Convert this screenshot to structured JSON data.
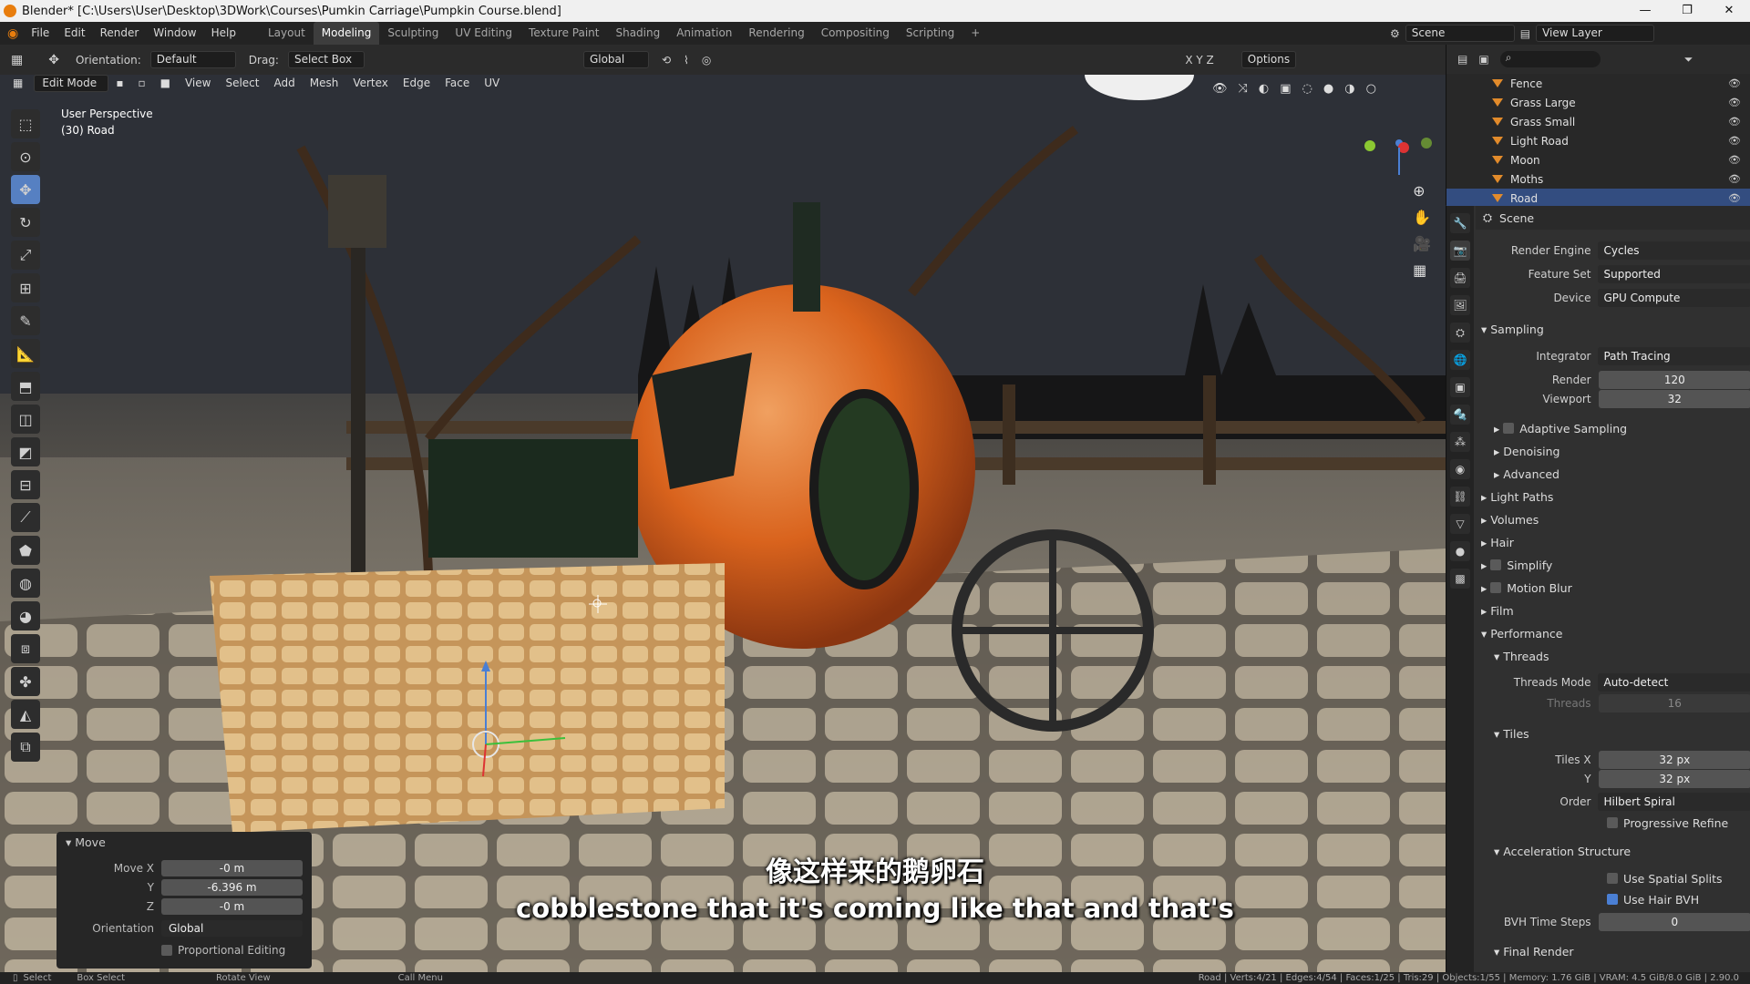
{
  "window": {
    "title": "Blender* [C:\\Users\\User\\Desktop\\3DWork\\Courses\\Pumkin Carriage\\Pumpkin Course.blend]"
  },
  "menu": [
    "File",
    "Edit",
    "Render",
    "Window",
    "Help"
  ],
  "workspaces": [
    "Layout",
    "Modeling",
    "Sculpting",
    "UV Editing",
    "Texture Paint",
    "Shading",
    "Animation",
    "Rendering",
    "Compositing",
    "Scripting"
  ],
  "active_workspace": "Modeling",
  "scene_field": "Scene",
  "view_layer_field": "View Layer",
  "header": {
    "orientation_label": "Orientation:",
    "orientation_value": "Default",
    "drag_label": "Drag:",
    "drag_value": "Select Box",
    "transform_space": "Global",
    "options": "Options"
  },
  "edit_header": {
    "mode": "Edit Mode",
    "items": [
      "View",
      "Select",
      "Add",
      "Mesh",
      "Vertex",
      "Edge",
      "Face",
      "UV"
    ]
  },
  "viewport": {
    "perspective": "User Perspective",
    "object": "(30) Road"
  },
  "outliner": [
    {
      "name": "Fence",
      "selected": false
    },
    {
      "name": "Grass Large",
      "selected": false
    },
    {
      "name": "Grass Small",
      "selected": false
    },
    {
      "name": "Light Road",
      "selected": false
    },
    {
      "name": "Moon",
      "selected": false
    },
    {
      "name": "Moths",
      "selected": false
    },
    {
      "name": "Road",
      "selected": true
    }
  ],
  "props": {
    "scene_title": "Scene",
    "render_engine": {
      "label": "Render Engine",
      "value": "Cycles"
    },
    "feature_set": {
      "label": "Feature Set",
      "value": "Supported"
    },
    "device": {
      "label": "Device",
      "value": "GPU Compute"
    },
    "sampling": "Sampling",
    "integrator": {
      "label": "Integrator",
      "value": "Path Tracing"
    },
    "render": {
      "label": "Render",
      "value": "120"
    },
    "viewport": {
      "label": "Viewport",
      "value": "32"
    },
    "adaptive": "Adaptive Sampling",
    "denoising": "Denoising",
    "advanced": "Advanced",
    "light_paths": "Light Paths",
    "volumes": "Volumes",
    "hair": "Hair",
    "simplify": "Simplify",
    "motion_blur": "Motion Blur",
    "film": "Film",
    "performance": "Performance",
    "threads": "Threads",
    "threads_mode": {
      "label": "Threads Mode",
      "value": "Auto-detect"
    },
    "threads_count": {
      "label": "Threads",
      "value": "16"
    },
    "tiles": "Tiles",
    "tiles_x": {
      "label": "Tiles X",
      "value": "32 px"
    },
    "tiles_y": {
      "label": "Y",
      "value": "32 px"
    },
    "order": {
      "label": "Order",
      "value": "Hilbert Spiral"
    },
    "progressive": "Progressive Refine",
    "accel": "Acceleration Structure",
    "spatial": "Use Spatial Splits",
    "hair_bvh": "Use Hair BVH",
    "bvh_steps": {
      "label": "BVH Time Steps",
      "value": "0"
    },
    "final_render": "Final Render"
  },
  "move_panel": {
    "title": "Move",
    "move_x": {
      "label": "Move X",
      "value": "-0 m"
    },
    "y": {
      "label": "Y",
      "value": "-6.396 m"
    },
    "z": {
      "label": "Z",
      "value": "-0 m"
    },
    "orientation": {
      "label": "Orientation",
      "value": "Global"
    },
    "proportional": "Proportional Editing"
  },
  "subtitles": {
    "zh": "像这样来的鹅卵石",
    "en": "cobblestone that it's coming like that and that's"
  },
  "status": {
    "select": "Select",
    "box_select": "Box Select",
    "rotate": "Rotate View",
    "call_menu": "Call Menu",
    "stats": "Road | Verts:4/21 | Edges:4/54 | Faces:1/25 | Tris:29 | Objects:1/55 | Memory: 1.76 GiB | VRAM: 4.5 GiB/8.0 GiB | 2.90.0"
  }
}
